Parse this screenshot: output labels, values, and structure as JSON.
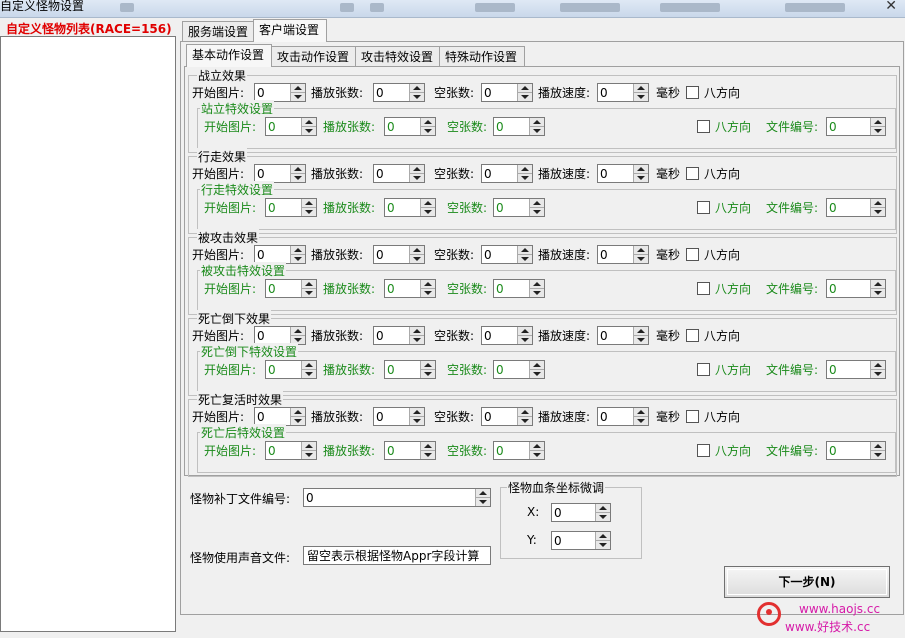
{
  "window": {
    "title": "自定义怪物设置"
  },
  "left": {
    "header": "自定义怪物列表(RACE=156)"
  },
  "outer_tabs": [
    "服务端设置",
    "客户端设置"
  ],
  "inner_tabs": [
    "基本动作设置",
    "攻击动作设置",
    "攻击特效设置",
    "特殊动作设置"
  ],
  "labels": {
    "start_img": "开始图片:",
    "frames": "播放张数:",
    "empty": "空张数:",
    "speed": "播放速度:",
    "ms": "毫秒",
    "eight_dir": "八方向",
    "file_no": "文件编号:"
  },
  "groups": [
    {
      "title": "战立效果",
      "sub_title": "站立特效设置",
      "start": "0",
      "frames": "0",
      "empty": "0",
      "speed": "0",
      "fx_start": "0",
      "fx_frames": "0",
      "fx_empty": "0",
      "file_no": "0"
    },
    {
      "title": "行走效果",
      "sub_title": "行走特效设置",
      "start": "0",
      "frames": "0",
      "empty": "0",
      "speed": "0",
      "fx_start": "0",
      "fx_frames": "0",
      "fx_empty": "0",
      "file_no": "0"
    },
    {
      "title": "被攻击效果",
      "sub_title": "被攻击特效设置",
      "start": "0",
      "frames": "0",
      "empty": "0",
      "speed": "0",
      "fx_start": "0",
      "fx_frames": "0",
      "fx_empty": "0",
      "file_no": "0"
    },
    {
      "title": "死亡倒下效果",
      "sub_title": "死亡倒下特效设置",
      "start": "0",
      "frames": "0",
      "empty": "0",
      "speed": "0",
      "fx_start": "0",
      "fx_frames": "0",
      "fx_empty": "0",
      "file_no": "0"
    },
    {
      "title": "死亡复活时效果",
      "sub_title": "死亡后特效设置",
      "start": "0",
      "frames": "0",
      "empty": "0",
      "speed": "0",
      "fx_start": "0",
      "fx_frames": "0",
      "fx_empty": "0",
      "file_no": "0"
    }
  ],
  "patch": {
    "label": "怪物补丁文件编号:",
    "value": "0"
  },
  "sound": {
    "label": "怪物使用声音文件:",
    "value": "留空表示根据怪物Appr字段计算"
  },
  "coords": {
    "title": "怪物血条坐标微调",
    "x_label": "X:",
    "x_value": "0",
    "y_label": "Y:",
    "y_value": "0"
  },
  "next_button": "下一步(N)",
  "watermark": {
    "line1": "www.haojs.cc",
    "line2": "www.好技术.cc"
  }
}
